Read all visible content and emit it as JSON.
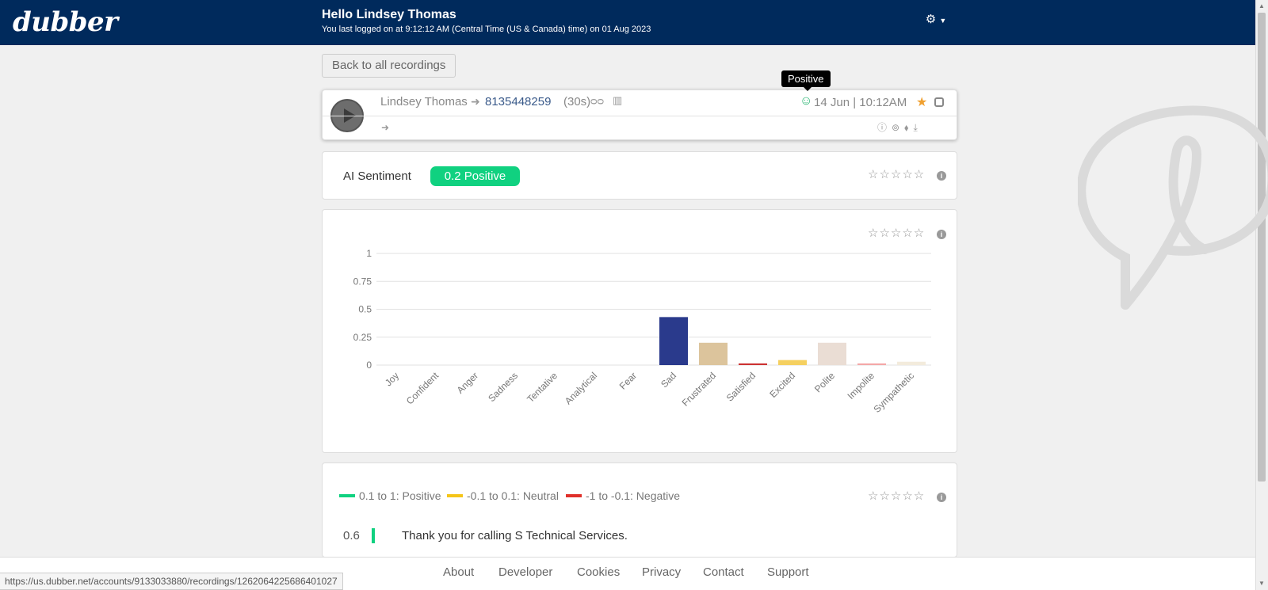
{
  "app": {
    "logo": "dubber"
  },
  "header": {
    "greeting": "Hello Lindsey Thomas",
    "last_logged": "You last logged on at 9:12:12 AM (Central Time (US & Canada) time) on 01 Aug 2023",
    "settings_icon": "gear-icon"
  },
  "toolbar": {
    "back_label": "Back to all recordings"
  },
  "recording": {
    "caller": "Lindsey Thomas",
    "arrow": "➜",
    "number": "8135448259",
    "duration": "(30s)",
    "voicemail_icon": "ᴑᴑ",
    "note_icon": "▥",
    "smile_icon": "☺",
    "datetime": "14 Jun | 10:12AM",
    "star_icon": "★",
    "forward_icon": "➜",
    "action_icons": "ⓘ⊚⬧⤓"
  },
  "tooltip": {
    "text": "Positive"
  },
  "sentiment": {
    "label": "AI Sentiment",
    "value": "0.2 Positive",
    "stars": "☆☆☆☆☆",
    "info": "i"
  },
  "chart_data": {
    "type": "bar",
    "categories": [
      "Joy",
      "Confident",
      "Anger",
      "Sadness",
      "Tentative",
      "Analytical",
      "Fear",
      "Sad",
      "Frustrated",
      "Satisfied",
      "Excited",
      "Polite",
      "Impolite",
      "Sympathetic"
    ],
    "values": [
      0,
      0,
      0,
      0,
      0,
      0,
      0,
      0.43,
      0.2,
      0.015,
      0.045,
      0.2,
      0.015,
      0.03
    ],
    "colors": [
      "#cccccc",
      "#cccccc",
      "#cccccc",
      "#cccccc",
      "#cccccc",
      "#cccccc",
      "#cccccc",
      "#2a3a8c",
      "#dcc49c",
      "#cc3333",
      "#f5d060",
      "#eaddd4",
      "#f4a8a8",
      "#f3ebdc"
    ],
    "yticks": [
      "0",
      "0.25",
      "0.5",
      "0.75",
      "1"
    ],
    "ylim": [
      0,
      1
    ],
    "grid": true
  },
  "chart_card": {
    "stars": "☆☆☆☆☆",
    "info": "i"
  },
  "transcript": {
    "stars": "☆☆☆☆☆",
    "info": "i",
    "legend": [
      {
        "label": "0.1 to 1: Positive",
        "color": "#10d180"
      },
      {
        "label": "-0.1 to 0.1: Neutral",
        "color": "#f5c518"
      },
      {
        "label": "-1 to -0.1: Negative",
        "color": "#e0302a"
      }
    ],
    "lines": [
      {
        "score": "0.6",
        "text": "Thank you for calling S Technical Services."
      }
    ]
  },
  "footer": {
    "links": [
      "About",
      "Developer",
      "Cookies",
      "Privacy",
      "Contact",
      "Support"
    ]
  },
  "status_url": "https://us.dubber.net/accounts/9133033880/recordings/1262064225686401027"
}
